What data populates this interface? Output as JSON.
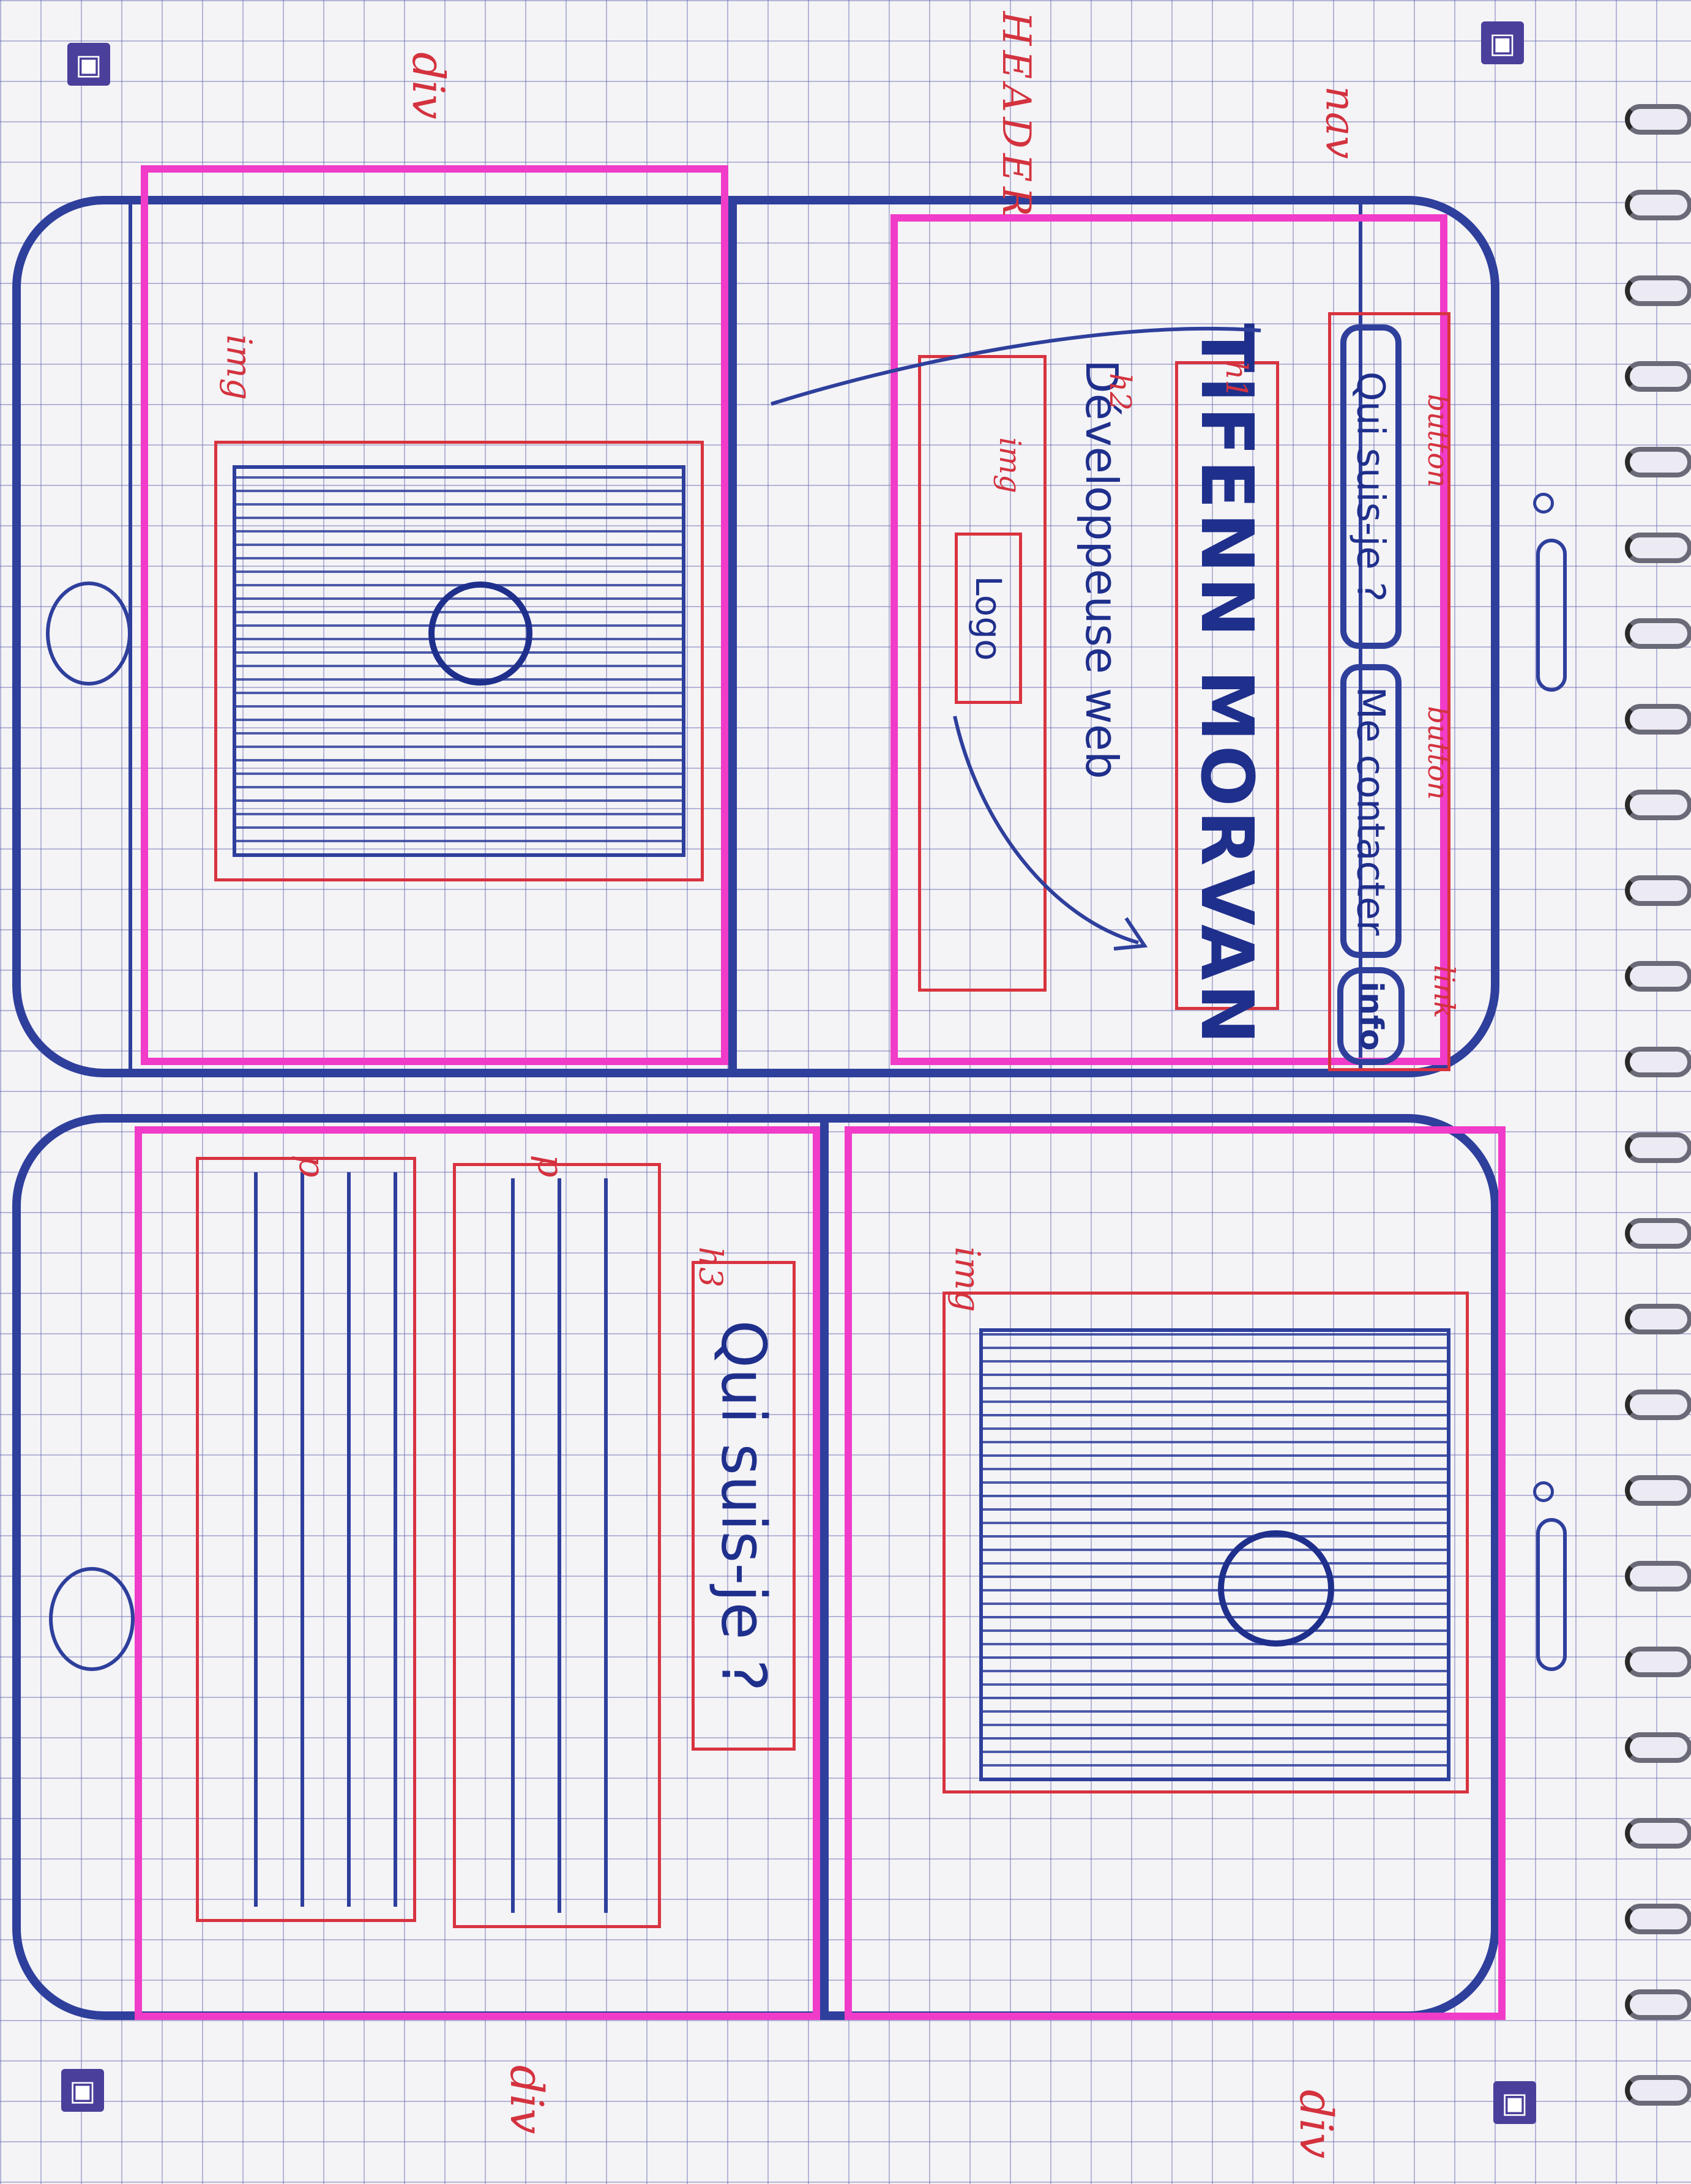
{
  "labels": {
    "nav": "nav",
    "header": "HEADER",
    "div_top_left": "div",
    "div_bottom_left": "div",
    "div_bottom_right": "div",
    "button_1": "button",
    "button_2": "button",
    "link": "link",
    "h1": "h1",
    "h2": "h2",
    "h3": "h3",
    "img_screen1": "img",
    "img_screen3": "img",
    "img_logo": "img",
    "p_1": "p",
    "p_2": "p"
  },
  "screen1": {
    "button_1_text": "Qui suis-je ?",
    "button_2_text": "Me contacter",
    "link_text": "info",
    "title": "TIFENN MORVAN",
    "subtitle": "Développeuse web",
    "logo_text": "Logo"
  },
  "screen3": {
    "heading": "Qui suis-je ?"
  },
  "colors": {
    "grid": "#5a5faa",
    "phone_outline": "#2e3f9c",
    "pink_highlight": "#f03cc8",
    "red_annotation": "#d8333f"
  }
}
